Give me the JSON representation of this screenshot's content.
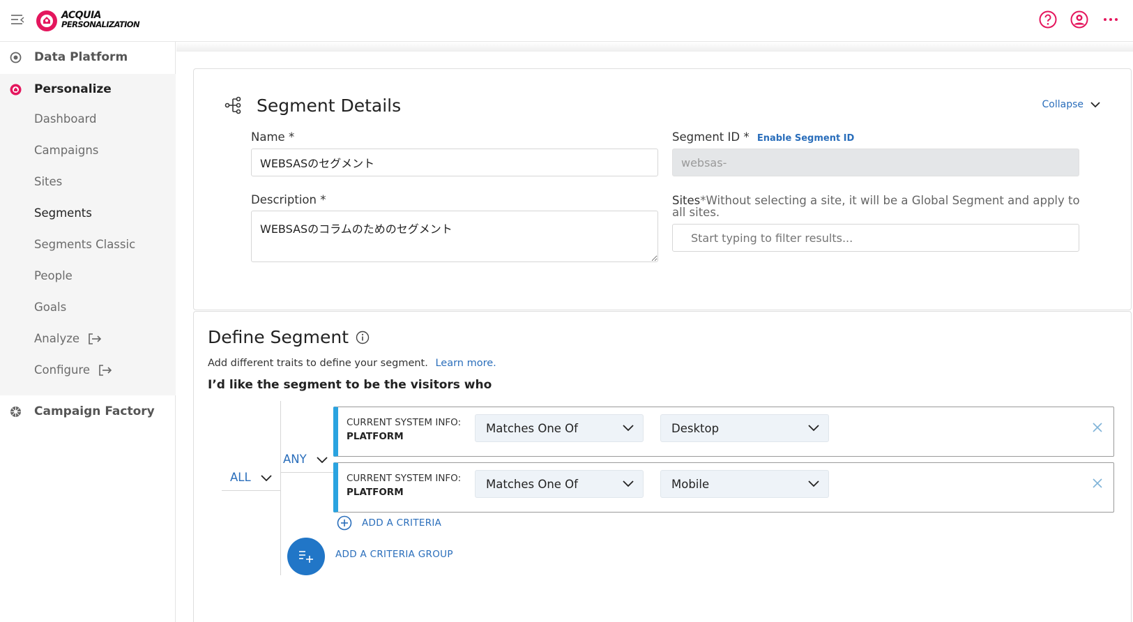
{
  "header": {
    "logo_line1": "ACQUIA",
    "logo_line2": "PERSONALIZATION",
    "brand_color": "#e4165d",
    "icons": [
      "menu-collapse-icon",
      "help-icon",
      "user-avatar-icon",
      "more-options-icon"
    ]
  },
  "sidebar": {
    "sections": [
      {
        "label": "Data Platform",
        "icon": "data-platform-icon"
      },
      {
        "label": "Personalize",
        "icon": "personalize-icon"
      },
      {
        "label": "Campaign Factory",
        "icon": "campaign-factory-icon"
      }
    ],
    "personalize_items": [
      {
        "label": "Dashboard"
      },
      {
        "label": "Campaigns"
      },
      {
        "label": "Sites"
      },
      {
        "label": "Segments",
        "active": true
      },
      {
        "label": "Segments Classic"
      },
      {
        "label": "People"
      },
      {
        "label": "Goals"
      },
      {
        "label": "Analyze",
        "external": true
      },
      {
        "label": "Configure",
        "external": true
      }
    ]
  },
  "segment_details": {
    "title": "Segment Details",
    "collapse_label": "Collapse",
    "name_label": "Name",
    "required_mark": "*",
    "name_value": "WEBSASのセグメント",
    "segment_id_label": "Segment ID",
    "enable_segment_id": "Enable Segment ID",
    "segment_id_value": "websas-",
    "description_label": "Description",
    "description_value": "WEBSASのコラムのためのセグメント",
    "sites_label": "Sites",
    "sites_hint": "Without selecting a site, it will be a Global Segment and apply to all sites.",
    "sites_placeholder": "Start typing to filter results..."
  },
  "define_segment": {
    "title": "Define Segment",
    "description": "Add different traits to define your segment.",
    "learn_more": "Learn more.",
    "lead": "I’d like the segment to be the visitors who",
    "all_label": "ALL",
    "any_label": "ANY",
    "criteria": [
      {
        "type_line1": "CURRENT SYSTEM INFO:",
        "type_line2": "PLATFORM",
        "operator": "Matches One Of",
        "value": "Desktop"
      },
      {
        "type_line1": "CURRENT SYSTEM INFO:",
        "type_line2": "PLATFORM",
        "operator": "Matches One Of",
        "value": "Mobile"
      }
    ],
    "add_criteria": "ADD A CRITERIA",
    "add_criteria_group": "ADD A CRITERIA GROUP",
    "accent_color": "#2aa3e0",
    "link_color": "#2a6ebb"
  }
}
